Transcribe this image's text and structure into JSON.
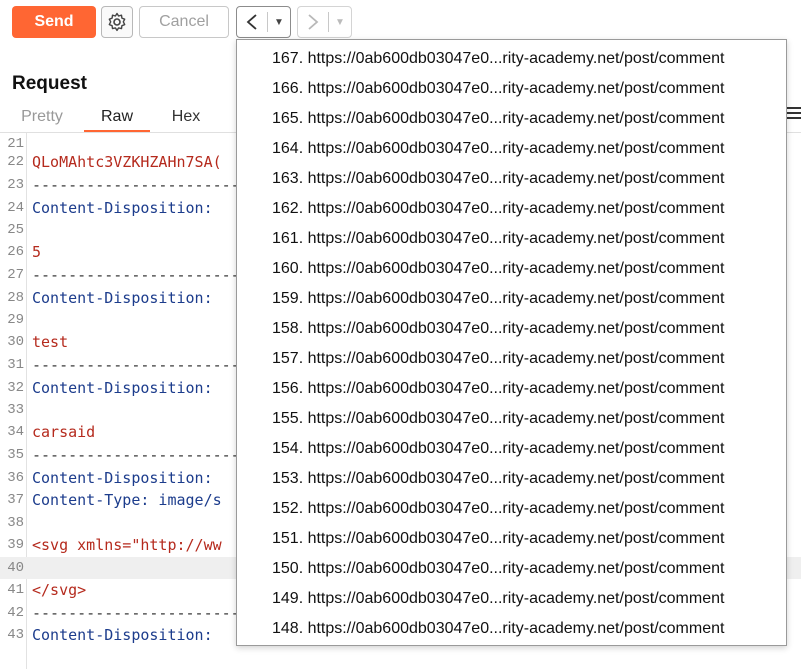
{
  "toolbar": {
    "send_label": "Send",
    "cancel_label": "Cancel",
    "back_arrow": "<",
    "forward_arrow": ">",
    "dropdown_glyph": "▼"
  },
  "request": {
    "title": "Request",
    "tabs": [
      {
        "label": "Pretty",
        "active": false
      },
      {
        "label": "Raw",
        "active": true
      },
      {
        "label": "Hex",
        "active": false
      }
    ]
  },
  "editor": {
    "lines": [
      {
        "n": "21",
        "text": ""
      },
      {
        "n": "22",
        "text": "QLoMAhtc3VZKHZAHn7SA("
      },
      {
        "n": "23",
        "text": "------------------------"
      },
      {
        "n": "24",
        "text": "Content-Disposition:"
      },
      {
        "n": "25",
        "text": ""
      },
      {
        "n": "26",
        "text": "5"
      },
      {
        "n": "27",
        "text": "------------------------"
      },
      {
        "n": "28",
        "text": "Content-Disposition:"
      },
      {
        "n": "29",
        "text": ""
      },
      {
        "n": "30",
        "text": "test"
      },
      {
        "n": "31",
        "text": "------------------------"
      },
      {
        "n": "32",
        "text": "Content-Disposition:"
      },
      {
        "n": "33",
        "text": ""
      },
      {
        "n": "34",
        "text": "carsaid"
      },
      {
        "n": "35",
        "text": "------------------------"
      },
      {
        "n": "36",
        "text": "Content-Disposition:"
      },
      {
        "n": "37",
        "text": "Content-Type: image/s"
      },
      {
        "n": "38",
        "text": ""
      },
      {
        "n": "39",
        "text": "<svg xmlns=\"http://ww"
      },
      {
        "n": "40",
        "text": ""
      },
      {
        "n": "41",
        "text": "</svg>"
      },
      {
        "n": "42",
        "text": "------------------------"
      },
      {
        "n": "43",
        "text": "Content-Disposition:"
      }
    ]
  },
  "history": {
    "items": [
      "167. https://0ab600db03047e0...rity-academy.net/post/comment",
      "166. https://0ab600db03047e0...rity-academy.net/post/comment",
      "165. https://0ab600db03047e0...rity-academy.net/post/comment",
      "164. https://0ab600db03047e0...rity-academy.net/post/comment",
      "163. https://0ab600db03047e0...rity-academy.net/post/comment",
      "162. https://0ab600db03047e0...rity-academy.net/post/comment",
      "161. https://0ab600db03047e0...rity-academy.net/post/comment",
      "160. https://0ab600db03047e0...rity-academy.net/post/comment",
      "159. https://0ab600db03047e0...rity-academy.net/post/comment",
      "158. https://0ab600db03047e0...rity-academy.net/post/comment",
      "157. https://0ab600db03047e0...rity-academy.net/post/comment",
      "156. https://0ab600db03047e0...rity-academy.net/post/comment",
      "155. https://0ab600db03047e0...rity-academy.net/post/comment",
      "154. https://0ab600db03047e0...rity-academy.net/post/comment",
      "153. https://0ab600db03047e0...rity-academy.net/post/comment",
      "152. https://0ab600db03047e0...rity-academy.net/post/comment",
      "151. https://0ab600db03047e0...rity-academy.net/post/comment",
      "150. https://0ab600db03047e0...rity-academy.net/post/comment",
      "149. https://0ab600db03047e0...rity-academy.net/post/comment",
      "148. https://0ab600db03047e0...rity-academy.net/post/comment"
    ]
  },
  "colors": {
    "accent": "#ff6633",
    "code_red": "#b52a1d",
    "code_blue": "#1c3c8c"
  }
}
